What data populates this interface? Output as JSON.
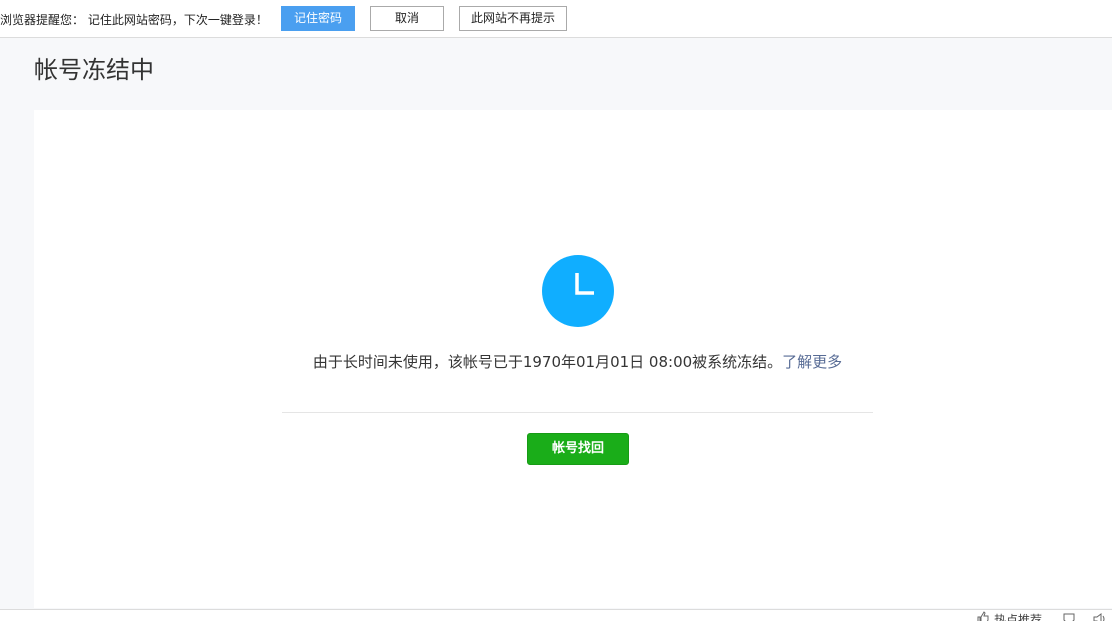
{
  "browser_bar": {
    "message": "浏览器提醒您： 记住此网站密码，下次一键登录！",
    "remember_label": "记住密码",
    "cancel_label": "取消",
    "never_label": "此网站不再提示"
  },
  "page": {
    "title": "帐号冻结中"
  },
  "notice": {
    "icon": "clock-icon",
    "text": "由于长时间未使用，该帐号已于1970年01月01日 08:00被系统冻结。",
    "link_label": "了解更多",
    "action_label": "帐号找回"
  },
  "status_bar": {
    "hot_label": "热点推荐"
  },
  "colors": {
    "accent_blue": "#10aeff",
    "button_green": "#1aad19",
    "link": "#576b95",
    "remember_button": "#4a9ff0"
  }
}
